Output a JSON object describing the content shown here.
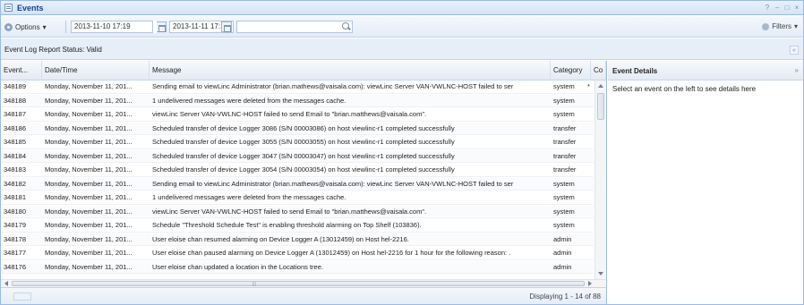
{
  "window": {
    "title": "Events",
    "tools": [
      "?",
      "–",
      "□",
      "×"
    ]
  },
  "toolbar": {
    "options_label": "Options",
    "options_arrow": "▾",
    "start_date": "2013-11-10 17:19",
    "end_date": "2013-11-11 17:19",
    "search_value": "",
    "filters_label": "Filters",
    "filters_arrow": "▾"
  },
  "status": {
    "text": "Event Log Report Status: Valid",
    "collapse_glyph": "«"
  },
  "grid": {
    "columns": [
      "Event...",
      "Date/Time",
      "Message",
      "Category",
      "Co"
    ],
    "rows": [
      {
        "id": "348189",
        "datetime": "Monday, November 11, 201...",
        "message": "Sending email to viewLinc Administrator (brian.mathews@vaisala.com): viewLinc Server VAN-VWLNC-HOST failed to ser",
        "category": "system",
        "extra": "*"
      },
      {
        "id": "348188",
        "datetime": "Monday, November 11, 201...",
        "message": "1 undelivered messages were deleted from the messages cache.",
        "category": "system",
        "extra": ""
      },
      {
        "id": "348187",
        "datetime": "Monday, November 11, 201...",
        "message": "viewLinc Server VAN-VWLNC-HOST failed to send Email to \"brian.matthews@vaisala.com\".",
        "category": "system",
        "extra": ""
      },
      {
        "id": "348186",
        "datetime": "Monday, November 11, 201...",
        "message": "Scheduled transfer of device Logger 3086 (S/N 00003086) on host viewlinc-r1 completed successfully",
        "category": "transfer",
        "extra": ""
      },
      {
        "id": "348185",
        "datetime": "Monday, November 11, 201...",
        "message": "Scheduled transfer of device Logger 3055 (S/N 00003055) on host viewlinc-r1 completed successfully",
        "category": "transfer",
        "extra": ""
      },
      {
        "id": "348184",
        "datetime": "Monday, November 11, 201...",
        "message": "Scheduled transfer of device Logger 3047 (S/N 00003047) on host viewlinc-r1 completed successfully",
        "category": "transfer",
        "extra": ""
      },
      {
        "id": "348183",
        "datetime": "Monday, November 11, 201...",
        "message": "Scheduled transfer of device Logger 3054 (S/N 00003054) on host viewlinc-r1 completed successfully",
        "category": "transfer",
        "extra": ""
      },
      {
        "id": "348182",
        "datetime": "Monday, November 11, 201...",
        "message": "Sending email to viewLinc Administrator (brian.mathews@vaisala.com): viewLinc Server VAN-VWLNC-HOST failed to ser",
        "category": "system",
        "extra": ""
      },
      {
        "id": "348181",
        "datetime": "Monday, November 11, 201...",
        "message": "1 undelivered messages were deleted from the messages cache.",
        "category": "system",
        "extra": ""
      },
      {
        "id": "348180",
        "datetime": "Monday, November 11, 201...",
        "message": "viewLinc Server VAN-VWLNC-HOST failed to send Email to \"brian.matthews@vaisala.com\".",
        "category": "system",
        "extra": ""
      },
      {
        "id": "348179",
        "datetime": "Monday, November 11, 201...",
        "message": "Schedule \"Threshold Schedule Test\" is enabling threshold alarming on Top Shelf (103836).",
        "category": "system",
        "extra": ""
      },
      {
        "id": "348178",
        "datetime": "Monday, November 11, 201...",
        "message": "User eloise chan resumed alarming on Device Logger A (13012459) on Host hel-2216.",
        "category": "admin",
        "extra": ""
      },
      {
        "id": "348177",
        "datetime": "Monday, November 11, 201...",
        "message": "User eloise chan paused alarming on Device Logger A (13012459) on Host hel-2216 for 1 hour for the following reason: .",
        "category": "admin",
        "extra": ""
      },
      {
        "id": "348176",
        "datetime": "Monday, November 11, 201...",
        "message": "User eloise chan updated a location in the Locations tree.",
        "category": "admin",
        "extra": ""
      }
    ]
  },
  "pager": {
    "displaying": "Displaying 1 - 14 of 88"
  },
  "details": {
    "title": "Event Details",
    "expand_glyph": "»",
    "message": "Select an event on the left to see details here"
  }
}
